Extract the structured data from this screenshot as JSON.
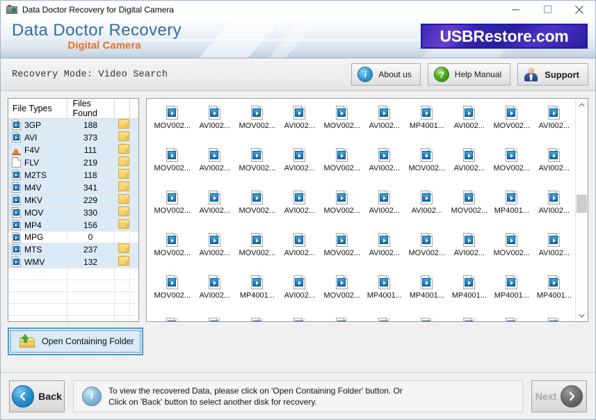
{
  "titlebar": {
    "title": "Data Doctor Recovery for Digital Camera",
    "minimize": "—",
    "maximize": "□",
    "close": "✕"
  },
  "banner": {
    "brand_main": "Data Doctor Recovery",
    "brand_sub": "Digital Camera",
    "logo": "USBRestore.com",
    "logo_bg": "#2a1d9c",
    "brand_main_color": "#2f6ea5",
    "brand_sub_color": "#e8702a"
  },
  "modebar": {
    "mode_text": "Recovery Mode: Video Search",
    "buttons": [
      {
        "label": "About us",
        "icon": "info-icon"
      },
      {
        "label": "Help Manual",
        "icon": "question-icon"
      },
      {
        "label": "Support",
        "icon": "person-icon"
      }
    ]
  },
  "filetypes": {
    "headers": [
      "File Types",
      "Files Found",
      "",
      ""
    ],
    "rows": [
      {
        "type": "3GP",
        "count": "188",
        "icon": "video-file-icon",
        "has_folder": true
      },
      {
        "type": "AVI",
        "count": "373",
        "icon": "video-file-icon",
        "has_folder": true
      },
      {
        "type": "F4V",
        "count": "111",
        "icon": "vlc-cone-icon",
        "has_folder": true
      },
      {
        "type": "FLV",
        "count": "219",
        "icon": "blank-file-icon",
        "has_folder": true
      },
      {
        "type": "M2TS",
        "count": "118",
        "icon": "video-file-icon",
        "has_folder": true
      },
      {
        "type": "M4V",
        "count": "341",
        "icon": "video-file-icon",
        "has_folder": true
      },
      {
        "type": "MKV",
        "count": "229",
        "icon": "video-file-icon",
        "has_folder": true
      },
      {
        "type": "MOV",
        "count": "330",
        "icon": "video-file-icon",
        "has_folder": true
      },
      {
        "type": "MP4",
        "count": "156",
        "icon": "video-file-icon",
        "has_folder": true
      },
      {
        "type": "MPG",
        "count": "0",
        "icon": "video-file-icon",
        "has_folder": false
      },
      {
        "type": "MTS",
        "count": "237",
        "icon": "video-file-icon",
        "has_folder": true
      },
      {
        "type": "WMV",
        "count": "132",
        "icon": "video-file-icon",
        "has_folder": true
      }
    ],
    "empty_rows": 6
  },
  "filegrid": {
    "rows": [
      [
        "MOV002...",
        "AVI002...",
        "MOV002...",
        "AVI002...",
        "MOV002...",
        "AVI002...",
        "MP4001...",
        "AVI002...",
        "MOV002...",
        "AVI002..."
      ],
      [
        "MOV002...",
        "AVI002...",
        "MOV002...",
        "AVI002...",
        "MOV002...",
        "AVI002...",
        "MOV002...",
        "AVI002...",
        "MOV002...",
        "AVI002..."
      ],
      [
        "MOV002...",
        "AVI002...",
        "MOV002...",
        "AVI002...",
        "MOV002...",
        "AVI002...",
        "AVI002...",
        "MOV002...",
        "MP4001...",
        "AVI002..."
      ],
      [
        "MOV002...",
        "AVI002...",
        "MOV002...",
        "AVI002...",
        "MOV002...",
        "AVI002...",
        "MOV002...",
        "AVI002...",
        "MOV002...",
        "AVI002..."
      ],
      [
        "MOV002...",
        "AVI002...",
        "MP4001...",
        "AVI002...",
        "MOV002...",
        "MP4001...",
        "MP4001...",
        "MP4001...",
        "MP4001...",
        "MP4001..."
      ],
      [
        "",
        "",
        "",
        "",
        "",
        "",
        "",
        "",
        "",
        ""
      ]
    ],
    "scroll_up": "˄",
    "scroll_down": "˅"
  },
  "open_folder_button": {
    "label": "Open Containing Folder",
    "icon": "open-folder-up-arrow-icon",
    "focus_color": "#3a9fe0"
  },
  "footer": {
    "back_label": "Back",
    "next_label": "Next",
    "status_line1": "To view the recovered Data, please click on 'Open Containing Folder' button. Or",
    "status_line2": "Click on 'Back' button to select another disk for recovery."
  }
}
